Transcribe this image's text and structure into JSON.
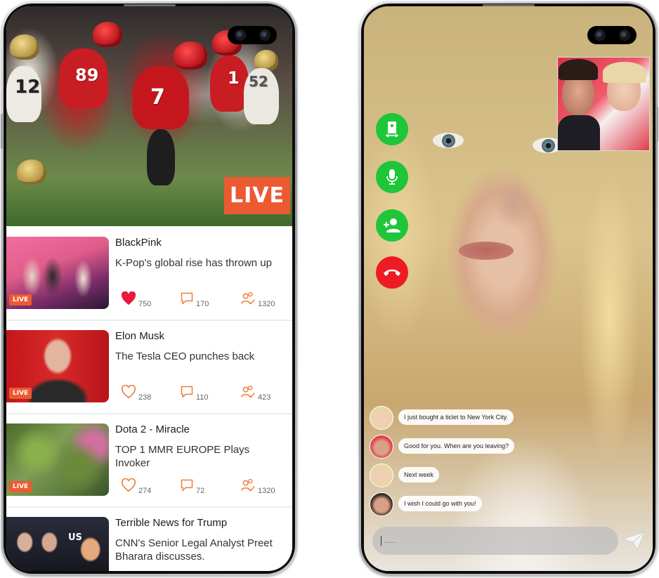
{
  "left_phone": {
    "hero": {
      "live_label": "LIVE",
      "jersey_numbers": [
        "7",
        "89",
        "12",
        "1",
        "52"
      ]
    },
    "feed": [
      {
        "title": "BlackPink",
        "subtitle": "K-Pop's global rise has thrown up",
        "live": "LIVE",
        "likes": "750",
        "comments": "170",
        "viewers": "1320",
        "liked": true
      },
      {
        "title": "Elon Musk",
        "subtitle": "The Tesla CEO punches back",
        "live": "LIVE",
        "likes": "238",
        "comments": "110",
        "viewers": "423",
        "liked": false
      },
      {
        "title": "Dota 2 - Miracle",
        "subtitle": "TOP 1 MMR EUROPE Plays Invoker",
        "live": "LIVE",
        "likes": "274",
        "comments": "72",
        "viewers": "1320",
        "liked": false
      },
      {
        "title": "Terrible News for Trump",
        "subtitle": "CNN's Senior Legal Analyst Preet Bharara discusses.",
        "thumb_text": "US"
      }
    ],
    "colors": {
      "accent": "#ec5a32",
      "heart": "#e8193c"
    }
  },
  "right_phone": {
    "call_controls": [
      {
        "name": "switch-camera-icon",
        "color": "#1fc63a"
      },
      {
        "name": "microphone-icon",
        "color": "#1fc63a"
      },
      {
        "name": "add-user-icon",
        "color": "#1fc63a"
      },
      {
        "name": "end-call-icon",
        "color": "#ed1c24"
      }
    ],
    "chat": [
      {
        "text": "I just bought a ticlet to New York City."
      },
      {
        "text": "Good for you. When are you leaving?"
      },
      {
        "text": "Next week"
      },
      {
        "text": "I wish I could go with you!"
      }
    ],
    "input": {
      "placeholder": "......"
    }
  }
}
